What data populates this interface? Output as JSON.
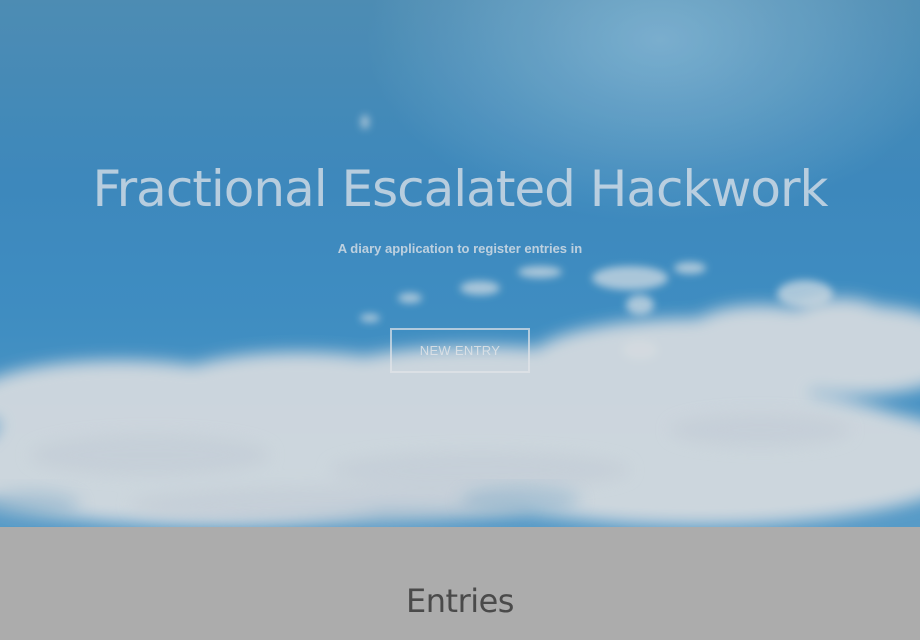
{
  "hero": {
    "title": "Fractional Escalated Hackwork",
    "subtitle": "A diary application to register entries in",
    "new_entry_label": "NEW ENTRY"
  },
  "entries": {
    "heading": "Entries"
  },
  "colors": {
    "sky": "#3f94cd",
    "section_background": "#acacac",
    "heading_text": "#4a4a4a"
  }
}
